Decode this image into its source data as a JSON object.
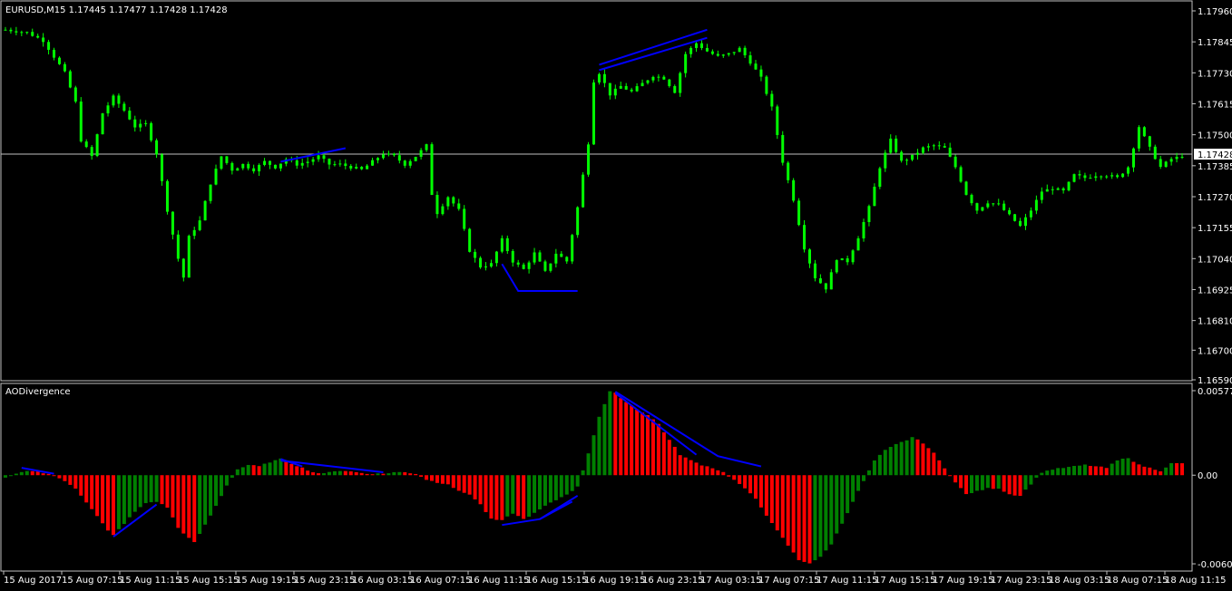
{
  "price_panel": {
    "title": "EURUSD,M15  1.17445 1.17477 1.17428 1.17428",
    "current_price_label": "1.17428",
    "candle_color": "#00ff00",
    "background": "#000000"
  },
  "indicator_panel": {
    "title": "AODivergence",
    "up_color": "#008000",
    "down_color": "#ff0000",
    "divergence_line_color": "#0000ff"
  },
  "chart_data": [
    {
      "type": "ohlc",
      "title": "EURUSD,M15  1.17445 1.17477 1.17428 1.17428",
      "ylim": [
        1.1659,
        1.1796
      ],
      "y_ticks": [
        "1.17960",
        "1.17845",
        "1.17730",
        "1.17615",
        "1.17500",
        "1.17385",
        "1.17270",
        "1.17155",
        "1.17040",
        "1.16925",
        "1.16810",
        "1.16700",
        "1.16590"
      ],
      "current_price": 1.17428,
      "x_ticks": [
        "15 Aug 2017",
        "15 Aug 07:15",
        "15 Aug 11:15",
        "15 Aug 15:15",
        "15 Aug 19:15",
        "15 Aug 23:15",
        "16 Aug 03:15",
        "16 Aug 07:15",
        "16 Aug 11:15",
        "16 Aug 15:15",
        "16 Aug 19:15",
        "16 Aug 23:15",
        "17 Aug 03:15",
        "17 Aug 07:15",
        "17 Aug 11:15",
        "17 Aug 15:15",
        "17 Aug 19:15",
        "17 Aug 23:15",
        "18 Aug 03:15",
        "18 Aug 07:15",
        "18 Aug 11:15"
      ],
      "close_path": [
        [
          0,
          1.1789
        ],
        [
          4,
          1.1788
        ],
        [
          7,
          1.1785
        ],
        [
          11,
          1.1773
        ],
        [
          13,
          1.1762
        ],
        [
          14,
          1.1748
        ],
        [
          16,
          1.1742
        ],
        [
          18,
          1.1758
        ],
        [
          20,
          1.1764
        ],
        [
          22,
          1.1759
        ],
        [
          24,
          1.1753
        ],
        [
          26,
          1.1754
        ],
        [
          28,
          1.1743
        ],
        [
          30,
          1.1722
        ],
        [
          32,
          1.1704
        ],
        [
          33,
          1.1697
        ],
        [
          34,
          1.1712
        ],
        [
          36,
          1.1718
        ],
        [
          38,
          1.1732
        ],
        [
          40,
          1.1742
        ],
        [
          42,
          1.1737
        ],
        [
          44,
          1.1739
        ],
        [
          46,
          1.1737
        ],
        [
          48,
          1.174
        ],
        [
          50,
          1.1738
        ],
        [
          52,
          1.1741
        ],
        [
          54,
          1.1739
        ],
        [
          56,
          1.174
        ],
        [
          58,
          1.1742
        ],
        [
          60,
          1.1739
        ],
        [
          62,
          1.1739
        ],
        [
          64,
          1.1738
        ],
        [
          66,
          1.1737
        ],
        [
          68,
          1.174
        ],
        [
          70,
          1.1743
        ],
        [
          72,
          1.1742
        ],
        [
          74,
          1.1739
        ],
        [
          76,
          1.1742
        ],
        [
          78,
          1.1746
        ],
        [
          79,
          1.1728
        ],
        [
          80,
          1.1721
        ],
        [
          82,
          1.1727
        ],
        [
          84,
          1.1722
        ],
        [
          86,
          1.1707
        ],
        [
          88,
          1.1701
        ],
        [
          90,
          1.1702
        ],
        [
          92,
          1.1711
        ],
        [
          94,
          1.1703
        ],
        [
          96,
          1.17
        ],
        [
          98,
          1.1706
        ],
        [
          100,
          1.1699
        ],
        [
          102,
          1.1706
        ],
        [
          104,
          1.1703
        ],
        [
          106,
          1.1723
        ],
        [
          108,
          1.1747
        ],
        [
          109,
          1.177
        ],
        [
          110,
          1.1773
        ],
        [
          112,
          1.1765
        ],
        [
          114,
          1.1768
        ],
        [
          116,
          1.1766
        ],
        [
          118,
          1.1769
        ],
        [
          120,
          1.1772
        ],
        [
          122,
          1.1771
        ],
        [
          124,
          1.1766
        ],
        [
          126,
          1.178
        ],
        [
          128,
          1.1784
        ],
        [
          130,
          1.1781
        ],
        [
          132,
          1.1779
        ],
        [
          134,
          1.178
        ],
        [
          136,
          1.1782
        ],
        [
          138,
          1.1777
        ],
        [
          140,
          1.1771
        ],
        [
          142,
          1.176
        ],
        [
          144,
          1.174
        ],
        [
          146,
          1.1726
        ],
        [
          148,
          1.1708
        ],
        [
          150,
          1.1697
        ],
        [
          152,
          1.1693
        ],
        [
          154,
          1.1704
        ],
        [
          156,
          1.1703
        ],
        [
          158,
          1.1712
        ],
        [
          160,
          1.1723
        ],
        [
          162,
          1.1738
        ],
        [
          164,
          1.1748
        ],
        [
          166,
          1.174
        ],
        [
          168,
          1.1742
        ],
        [
          170,
          1.1745
        ],
        [
          172,
          1.1746
        ],
        [
          174,
          1.1745
        ],
        [
          176,
          1.1738
        ],
        [
          178,
          1.1728
        ],
        [
          180,
          1.1722
        ],
        [
          182,
          1.1725
        ],
        [
          184,
          1.1724
        ],
        [
          186,
          1.172
        ],
        [
          188,
          1.1716
        ],
        [
          190,
          1.1722
        ],
        [
          192,
          1.1729
        ],
        [
          194,
          1.173
        ],
        [
          196,
          1.1729
        ],
        [
          198,
          1.1735
        ],
        [
          200,
          1.1734
        ],
        [
          202,
          1.1735
        ],
        [
          204,
          1.1735
        ],
        [
          206,
          1.1734
        ],
        [
          208,
          1.1738
        ],
        [
          210,
          1.1753
        ],
        [
          212,
          1.1745
        ],
        [
          214,
          1.1738
        ],
        [
          216,
          1.1741
        ],
        [
          218,
          1.1742
        ]
      ],
      "divergence_lines": [
        [
          [
            51,
            1.174
          ],
          [
            63,
            1.1745
          ]
        ],
        [
          [
            92,
            1.1702
          ],
          [
            95,
            1.1692
          ],
          [
            106,
            1.1692
          ]
        ],
        [
          [
            110,
            1.1776
          ],
          [
            130,
            1.1789
          ]
        ],
        [
          [
            110,
            1.1774
          ],
          [
            130,
            1.1786
          ]
        ]
      ]
    },
    {
      "type": "bar",
      "title": "AODivergence",
      "ylim": [
        -0.00605,
        0.00577
      ],
      "y_ticks": [
        "0.005771",
        "0.00",
        "-0.006051"
      ],
      "points": [
        [
          0,
          -0.0002
        ],
        [
          3,
          0.0002
        ],
        [
          5,
          0.0003
        ],
        [
          8,
          0.0001
        ],
        [
          10,
          -0.0002
        ],
        [
          13,
          -0.0009
        ],
        [
          16,
          -0.0023
        ],
        [
          19,
          -0.0038
        ],
        [
          20,
          -0.0041
        ],
        [
          22,
          -0.0033
        ],
        [
          24,
          -0.0025
        ],
        [
          26,
          -0.0019
        ],
        [
          28,
          -0.0018
        ],
        [
          30,
          -0.0022
        ],
        [
          32,
          -0.0036
        ],
        [
          34,
          -0.0043
        ],
        [
          35,
          -0.0046
        ],
        [
          37,
          -0.0034
        ],
        [
          39,
          -0.0021
        ],
        [
          41,
          -0.0007
        ],
        [
          43,
          0.0004
        ],
        [
          45,
          0.0007
        ],
        [
          47,
          0.0006
        ],
        [
          49,
          0.0009
        ],
        [
          51,
          0.0011
        ],
        [
          53,
          0.0008
        ],
        [
          55,
          0.0005
        ],
        [
          57,
          0.0002
        ],
        [
          59,
          0.0001
        ],
        [
          61,
          0.0003
        ],
        [
          63,
          0.0003
        ],
        [
          65,
          0.0002
        ],
        [
          67,
          0.0001
        ],
        [
          70,
          0.0001
        ],
        [
          72,
          0.0002
        ],
        [
          74,
          0.0002
        ],
        [
          76,
          0.0001
        ],
        [
          78,
          -0.0003
        ],
        [
          80,
          -0.0005
        ],
        [
          82,
          -0.0006
        ],
        [
          84,
          -0.0011
        ],
        [
          86,
          -0.0013
        ],
        [
          88,
          -0.002
        ],
        [
          90,
          -0.003
        ],
        [
          92,
          -0.0031
        ],
        [
          94,
          -0.0026
        ],
        [
          96,
          -0.003
        ],
        [
          98,
          -0.0026
        ],
        [
          100,
          -0.0021
        ],
        [
          102,
          -0.0017
        ],
        [
          104,
          -0.0013
        ],
        [
          106,
          -0.0008
        ],
        [
          108,
          0.0015
        ],
        [
          110,
          0.004
        ],
        [
          112,
          0.0057
        ],
        [
          113,
          0.0056
        ],
        [
          115,
          0.005
        ],
        [
          117,
          0.0045
        ],
        [
          119,
          0.0041
        ],
        [
          121,
          0.0035
        ],
        [
          123,
          0.0024
        ],
        [
          125,
          0.0014
        ],
        [
          127,
          0.001
        ],
        [
          129,
          0.0007
        ],
        [
          131,
          0.0005
        ],
        [
          133,
          0.0002
        ],
        [
          136,
          -0.0006
        ],
        [
          139,
          -0.0016
        ],
        [
          142,
          -0.0033
        ],
        [
          145,
          -0.0048
        ],
        [
          147,
          -0.0058
        ],
        [
          149,
          -0.006
        ],
        [
          151,
          -0.0056
        ],
        [
          153,
          -0.0047
        ],
        [
          155,
          -0.0033
        ],
        [
          157,
          -0.0018
        ],
        [
          159,
          -0.0004
        ],
        [
          161,
          0.001
        ],
        [
          163,
          0.0017
        ],
        [
          165,
          0.0021
        ],
        [
          167,
          0.0024
        ],
        [
          168,
          0.0026
        ],
        [
          170,
          0.0022
        ],
        [
          172,
          0.0015
        ],
        [
          174,
          0.0005
        ],
        [
          176,
          -0.0005
        ],
        [
          178,
          -0.0013
        ],
        [
          180,
          -0.0011
        ],
        [
          182,
          -0.0009
        ],
        [
          184,
          -0.0009
        ],
        [
          186,
          -0.0013
        ],
        [
          188,
          -0.0014
        ],
        [
          190,
          -0.0006
        ],
        [
          192,
          0.0002
        ],
        [
          194,
          0.0004
        ],
        [
          196,
          0.0005
        ],
        [
          198,
          0.0006
        ],
        [
          200,
          0.0007
        ],
        [
          202,
          0.0006
        ],
        [
          204,
          0.0005
        ],
        [
          206,
          0.001
        ],
        [
          208,
          0.0012
        ],
        [
          210,
          0.0007
        ],
        [
          212,
          0.0005
        ],
        [
          214,
          0.0003
        ],
        [
          216,
          0.0008
        ]
      ],
      "divergence_lines": [
        [
          [
            3,
            0.0005
          ],
          [
            9,
            0.0001
          ]
        ],
        [
          [
            20,
            -0.0042
          ],
          [
            28,
            -0.002
          ]
        ],
        [
          [
            51,
            0.0011
          ],
          [
            55,
            0.0006
          ]
        ],
        [
          [
            51,
            0.001
          ],
          [
            70,
            0.0002
          ]
        ],
        [
          [
            92,
            -0.0034
          ],
          [
            99,
            -0.003
          ],
          [
            106,
            -0.0014
          ]
        ],
        [
          [
            99,
            -0.003
          ],
          [
            105,
            -0.0018
          ]
        ],
        [
          [
            113,
            0.0057
          ],
          [
            132,
            0.0013
          ],
          [
            140,
            0.0006
          ]
        ],
        [
          [
            113,
            0.0056
          ],
          [
            128,
            0.0014
          ]
        ]
      ]
    }
  ]
}
